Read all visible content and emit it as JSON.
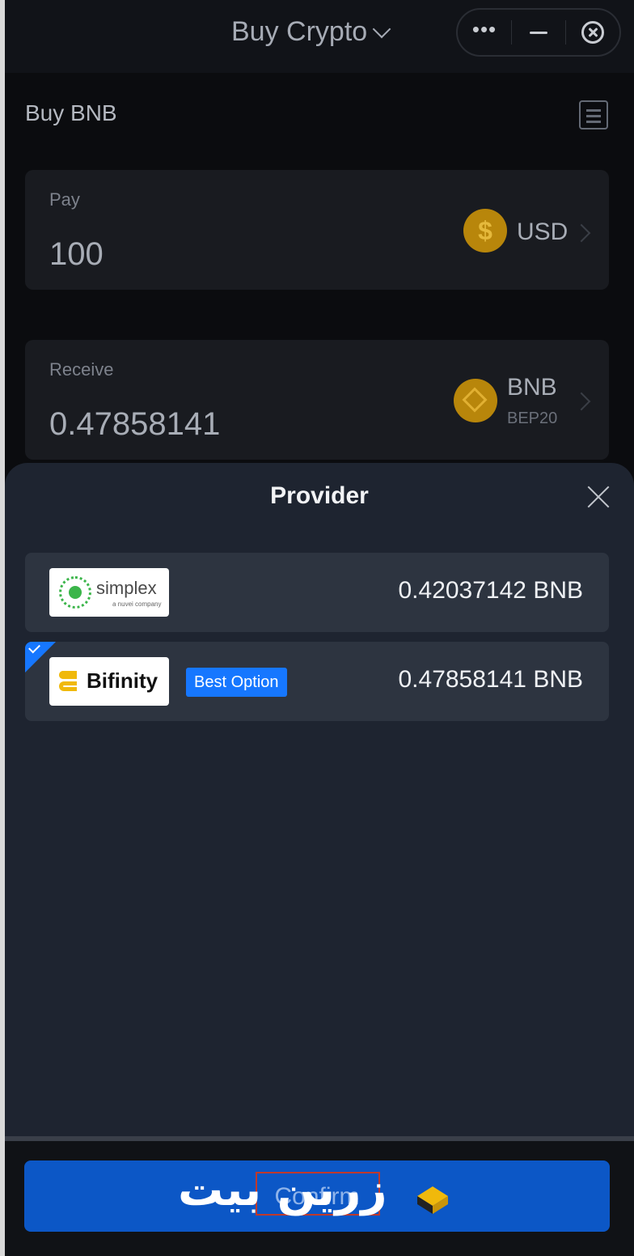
{
  "titlebar": {
    "title": "Buy Crypto",
    "icons": {
      "dropdown": "chevron-down-icon",
      "more": "more-dots-icon",
      "minimize": "minimize-icon",
      "close": "close-circle-icon"
    },
    "more_glyph": "•••"
  },
  "page": {
    "heading": "Buy BNB",
    "history_icon": "receipt-icon"
  },
  "pay": {
    "label": "Pay",
    "amount": "100",
    "currency": "USD",
    "currency_icon": "dollar-coin-icon",
    "currency_glyph": "$"
  },
  "receive": {
    "label": "Receive",
    "amount": "0.47858141",
    "currency": "BNB",
    "network": "BEP20",
    "currency_icon": "bnb-coin-icon"
  },
  "provider_sheet": {
    "title": "Provider",
    "close_icon": "close-icon",
    "providers": [
      {
        "name": "simplex",
        "subtitle": "a nuvei company",
        "amount": "0.42037142 BNB",
        "selected": false
      },
      {
        "name": "Bifinity",
        "badge": "Best Option",
        "amount": "0.47858141 BNB",
        "selected": true
      }
    ]
  },
  "footer": {
    "confirm_label": "Confirm",
    "watermark_text": "زرین بیت"
  },
  "colors": {
    "accent": "#1677ff",
    "confirm_bg": "#0c57c6",
    "sheet_bg": "#1e2430",
    "row_bg": "#2d3440",
    "coin_gold": "#b8860b"
  }
}
